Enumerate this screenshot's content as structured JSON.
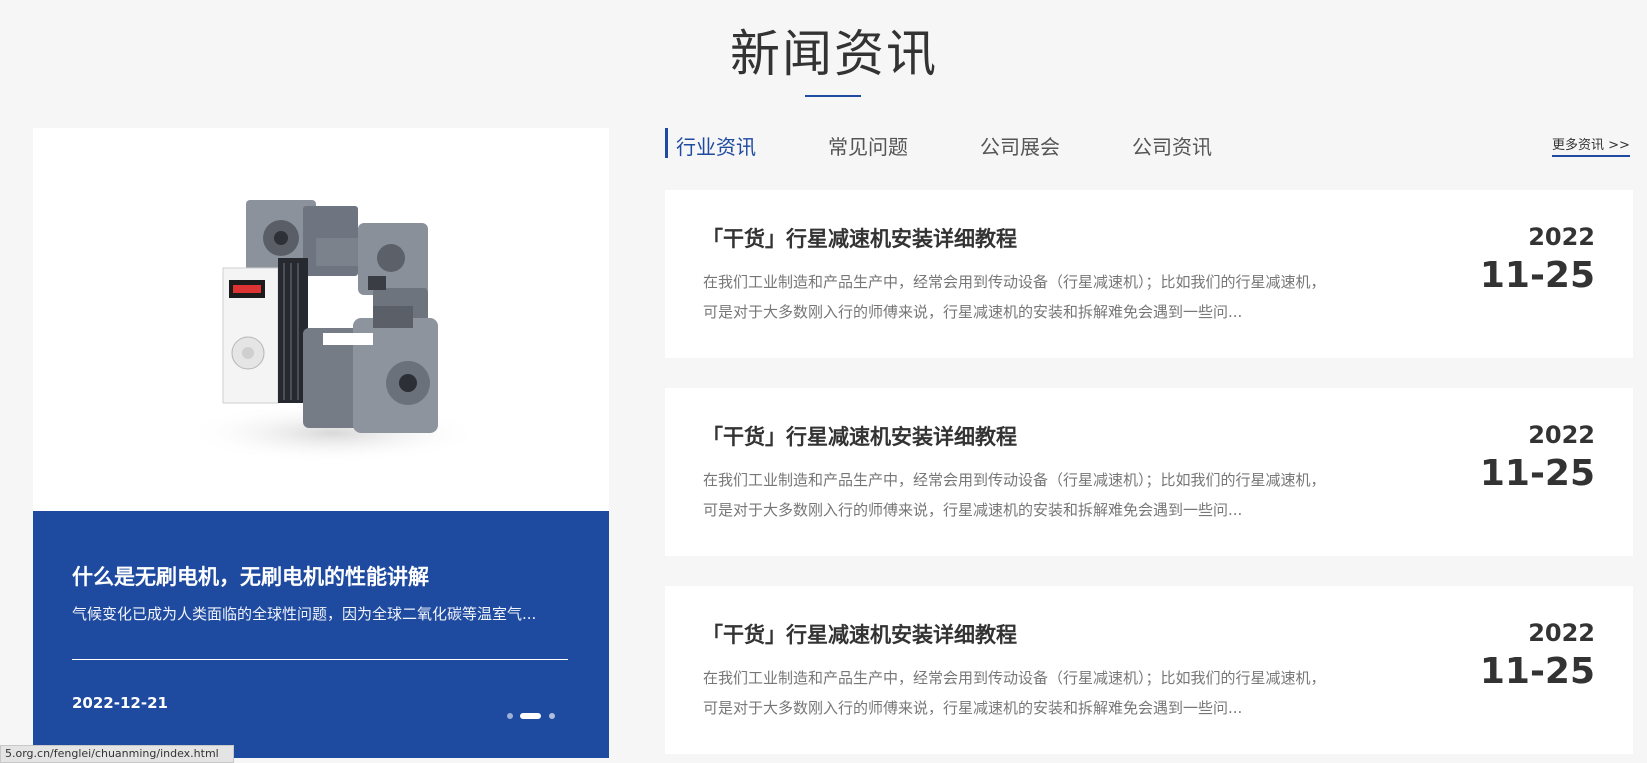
{
  "section": {
    "title": "新闻资讯"
  },
  "feature": {
    "title": "什么是无刷电机，无刷电机的性能讲解",
    "description": "气候变化已成为人类面临的全球性问题，因为全球二氧化碳等温室气...",
    "date": "2022-12-21",
    "carousel": {
      "total": 3,
      "active": 2
    }
  },
  "tabs": [
    {
      "label": "行业资讯",
      "active": true
    },
    {
      "label": "常见问题",
      "active": false
    },
    {
      "label": "公司展会",
      "active": false
    },
    {
      "label": "公司资讯",
      "active": false
    }
  ],
  "more_link": "更多资讯 >>",
  "news": [
    {
      "title": "「干货」行星减速机安装详细教程",
      "summary": "在我们工业制造和产品生产中，经常会用到传动设备（行星减速机）；比如我们的行星减速机，可是对于大多数刚入行的师傅来说，行星减速机的安装和拆解难免会遇到一些问...",
      "year": "2022",
      "day": "11-25"
    },
    {
      "title": "「干货」行星减速机安装详细教程",
      "summary": "在我们工业制造和产品生产中，经常会用到传动设备（行星减速机）；比如我们的行星减速机，可是对于大多数刚入行的师傅来说，行星减速机的安装和拆解难免会遇到一些问...",
      "year": "2022",
      "day": "11-25"
    },
    {
      "title": "「干货」行星减速机安装详细教程",
      "summary": "在我们工业制造和产品生产中，经常会用到传动设备（行星减速机）；比如我们的行星减速机，可是对于大多数刚入行的师傅来说，行星减速机的安装和拆解难免会遇到一些问...",
      "year": "2022",
      "day": "11-25"
    }
  ],
  "status_bar": {
    "url": "5.org.cn/fenglei/chuanming/index.html"
  },
  "colors": {
    "accent": "#1e4aa0",
    "background": "#f6f6f6",
    "card": "#ffffff"
  }
}
